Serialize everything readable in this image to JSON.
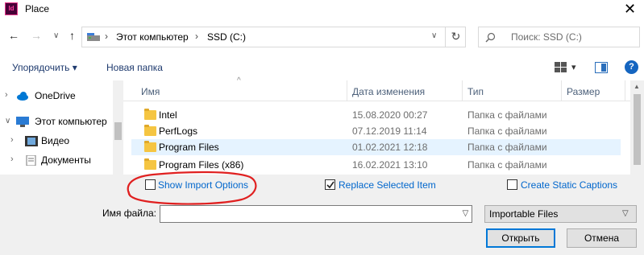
{
  "window": {
    "title": "Place",
    "app_icon_text": "Id",
    "close_glyph": "✕"
  },
  "nav": {
    "back": "←",
    "forward": "→",
    "recent": "∨",
    "up": "↑",
    "breadcrumb": [
      "Этот компьютер",
      "SSD (C:)"
    ],
    "breadcrumb_sep": "›",
    "address_dropdown": "∨",
    "refresh": "↻",
    "search_placeholder": "Поиск: SSD (C:)"
  },
  "toolbar": {
    "organize": "Упорядочить",
    "organize_arrow": "▾",
    "new_folder": "Новая папка",
    "view_arrow": "▾",
    "help": "?"
  },
  "sidebar": {
    "items": [
      {
        "label": "OneDrive",
        "icon": "cloud-icon"
      },
      {
        "label": "Этот компьютер",
        "icon": "computer-icon"
      },
      {
        "label": "Видео",
        "icon": "video-icon"
      },
      {
        "label": "Документы",
        "icon": "documents-icon"
      }
    ]
  },
  "files": {
    "columns": [
      "Имя",
      "Дата изменения",
      "Тип",
      "Размер"
    ],
    "sort_indicator": "^",
    "rows": [
      {
        "name": "Intel",
        "date": "15.08.2020 00:27",
        "type": "Папка с файлами"
      },
      {
        "name": "PerfLogs",
        "date": "07.12.2019 11:14",
        "type": "Папка с файлами"
      },
      {
        "name": "Program Files",
        "date": "01.02.2021 12:18",
        "type": "Папка с файлами"
      },
      {
        "name": "Program Files (x86)",
        "date": "16.02.2021 13:10",
        "type": "Папка с файлами"
      }
    ]
  },
  "options": {
    "show_import": {
      "label": "Show Import Options",
      "checked": false
    },
    "replace_selected": {
      "label": "Replace Selected Item",
      "checked": true
    },
    "static_captions": {
      "label": "Create Static Captions",
      "checked": false
    }
  },
  "filename": {
    "label": "Имя файла:",
    "value": ""
  },
  "filetype": {
    "value": "Importable Files"
  },
  "buttons": {
    "open": "Открыть",
    "cancel": "Отмена"
  },
  "annotation": {
    "color": "#e02020"
  }
}
